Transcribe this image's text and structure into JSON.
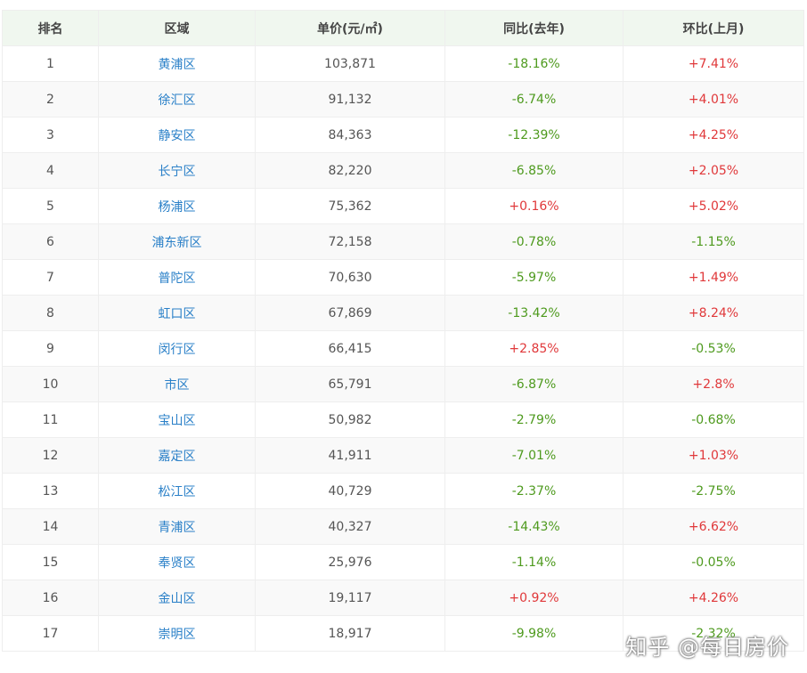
{
  "header": {
    "rank": "排名",
    "district": "区域",
    "price": "单价(元/㎡)",
    "yoy": "同比(去年)",
    "mom": "环比(上月)"
  },
  "rows": [
    {
      "rank": "1",
      "district": "黄浦区",
      "price": "103,871",
      "yoy": "-18.16%",
      "mom": "+7.41%"
    },
    {
      "rank": "2",
      "district": "徐汇区",
      "price": "91,132",
      "yoy": "-6.74%",
      "mom": "+4.01%"
    },
    {
      "rank": "3",
      "district": "静安区",
      "price": "84,363",
      "yoy": "-12.39%",
      "mom": "+4.25%"
    },
    {
      "rank": "4",
      "district": "长宁区",
      "price": "82,220",
      "yoy": "-6.85%",
      "mom": "+2.05%"
    },
    {
      "rank": "5",
      "district": "杨浦区",
      "price": "75,362",
      "yoy": "+0.16%",
      "mom": "+5.02%"
    },
    {
      "rank": "6",
      "district": "浦东新区",
      "price": "72,158",
      "yoy": "-0.78%",
      "mom": "-1.15%"
    },
    {
      "rank": "7",
      "district": "普陀区",
      "price": "70,630",
      "yoy": "-5.97%",
      "mom": "+1.49%"
    },
    {
      "rank": "8",
      "district": "虹口区",
      "price": "67,869",
      "yoy": "-13.42%",
      "mom": "+8.24%"
    },
    {
      "rank": "9",
      "district": "闵行区",
      "price": "66,415",
      "yoy": "+2.85%",
      "mom": "-0.53%"
    },
    {
      "rank": "10",
      "district": "市区",
      "price": "65,791",
      "yoy": "-6.87%",
      "mom": "+2.8%"
    },
    {
      "rank": "11",
      "district": "宝山区",
      "price": "50,982",
      "yoy": "-2.79%",
      "mom": "-0.68%"
    },
    {
      "rank": "12",
      "district": "嘉定区",
      "price": "41,911",
      "yoy": "-7.01%",
      "mom": "+1.03%"
    },
    {
      "rank": "13",
      "district": "松江区",
      "price": "40,729",
      "yoy": "-2.37%",
      "mom": "-2.75%"
    },
    {
      "rank": "14",
      "district": "青浦区",
      "price": "40,327",
      "yoy": "-14.43%",
      "mom": "+6.62%"
    },
    {
      "rank": "15",
      "district": "奉贤区",
      "price": "25,976",
      "yoy": "-1.14%",
      "mom": "-0.05%"
    },
    {
      "rank": "16",
      "district": "金山区",
      "price": "19,117",
      "yoy": "+0.92%",
      "mom": "+4.26%"
    },
    {
      "rank": "17",
      "district": "崇明区",
      "price": "18,917",
      "yoy": "-9.98%",
      "mom": "-2.32%"
    }
  ],
  "colors": {
    "positive": "#e0383a",
    "negative": "#4e9a1e",
    "link": "#2a80c8",
    "header_bg": "#f0f7ef"
  },
  "watermark": "知乎 @每日房价"
}
